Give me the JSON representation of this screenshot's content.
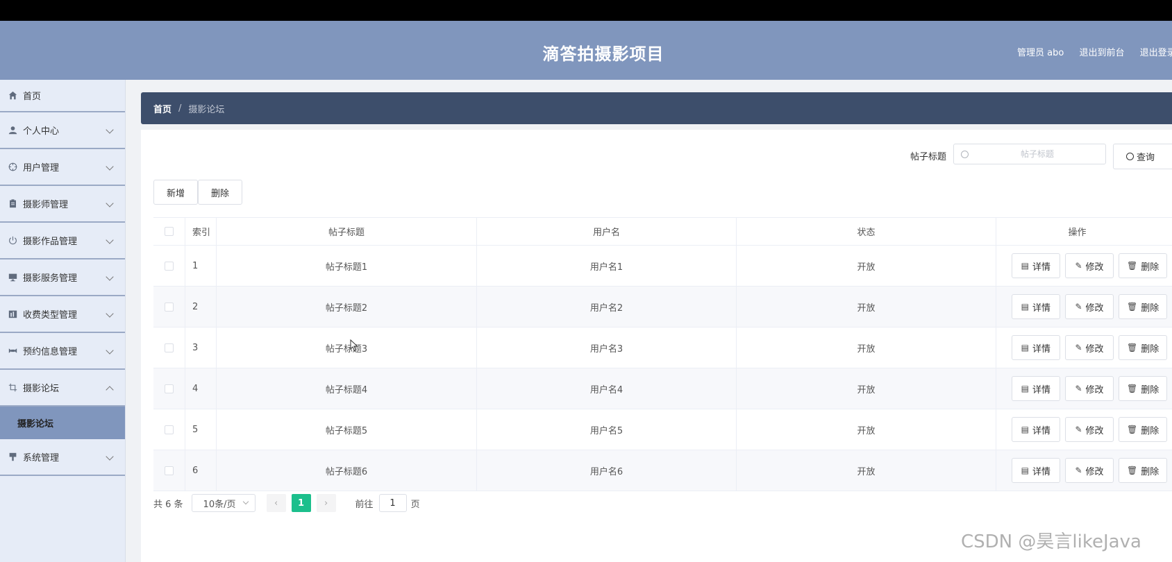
{
  "header": {
    "title": "滴答拍摄影项目",
    "user": "管理员 abo",
    "link_front": "退出到前台",
    "link_logout": "退出登录"
  },
  "sidebar": {
    "items": [
      {
        "label": "首页",
        "icon": "home-icon"
      },
      {
        "label": "个人中心",
        "icon": "user-icon"
      },
      {
        "label": "用户管理",
        "icon": "target-icon"
      },
      {
        "label": "摄影师管理",
        "icon": "clipboard-icon"
      },
      {
        "label": "摄影作品管理",
        "icon": "power-icon"
      },
      {
        "label": "摄影服务管理",
        "icon": "monitor-icon"
      },
      {
        "label": "收费类型管理",
        "icon": "chart-icon"
      },
      {
        "label": "预约信息管理",
        "icon": "camera-icon"
      },
      {
        "label": "摄影论坛",
        "icon": "crop-icon"
      },
      {
        "label": "系统管理",
        "icon": "paint-icon"
      }
    ],
    "submenu_active": "摄影论坛"
  },
  "breadcrumb": {
    "home": "首页",
    "separator": "/",
    "current": "摄影论坛"
  },
  "search": {
    "label": "帖子标题",
    "placeholder": "帖子标题",
    "button": "查询"
  },
  "toolbar": {
    "add_label": "新增",
    "delete_label": "删除"
  },
  "table": {
    "headers": {
      "index": "索引",
      "title": "帖子标题",
      "user": "用户名",
      "status": "状态",
      "ops": "操作"
    },
    "rows": [
      {
        "index": "1",
        "title": "帖子标题1",
        "user": "用户名1",
        "status": "开放"
      },
      {
        "index": "2",
        "title": "帖子标题2",
        "user": "用户名2",
        "status": "开放"
      },
      {
        "index": "3",
        "title": "帖子标题3",
        "user": "用户名3",
        "status": "开放"
      },
      {
        "index": "4",
        "title": "帖子标题4",
        "user": "用户名4",
        "status": "开放"
      },
      {
        "index": "5",
        "title": "帖子标题5",
        "user": "用户名5",
        "status": "开放"
      },
      {
        "index": "6",
        "title": "帖子标题6",
        "user": "用户名6",
        "status": "开放"
      }
    ],
    "op_labels": {
      "detail": "详情",
      "edit": "修改",
      "remove": "删除"
    }
  },
  "pagination": {
    "total": "共 6 条",
    "page_size": "10条/页",
    "current_page": "1",
    "goto_prefix": "前往",
    "goto_value": "1",
    "goto_suffix": "页"
  },
  "watermark": "CSDN @昊言likeJava",
  "colors": {
    "header_bg": "#8096bd",
    "breadcrumb_bg": "#3d4e6b",
    "sidebar_bg": "#e6ecf7",
    "active_page": "#1cbf8c"
  }
}
